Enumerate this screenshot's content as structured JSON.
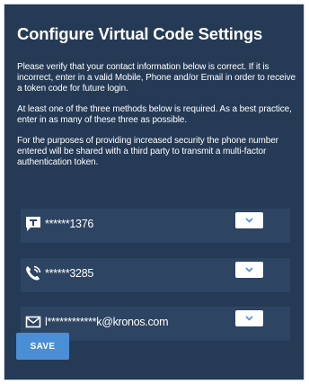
{
  "dialog": {
    "title": "Configure Virtual Code Settings",
    "paragraphs": [
      "Please verify that your contact information below is correct. If it is incorrect, enter in a valid Mobile, Phone and/or Email in order to receive a token code for future login.",
      "At least one of the three methods below is required. As a best practice, enter in as many of these three as possible.",
      "For the purposes of providing increased security the phone number entered will be shared with a third party to transmit a multi-factor authentication token."
    ]
  },
  "fields": [
    {
      "icon": "sms-message-icon",
      "value": "******1376"
    },
    {
      "icon": "phone-call-icon",
      "value": "******3285"
    },
    {
      "icon": "email-envelope-icon",
      "value": "l************k@kronos.com"
    }
  ],
  "dropdown_icon": "chevron-down-icon",
  "buttons": {
    "save_label": "SAVE"
  },
  "colors": {
    "panel_background": "#253a55",
    "field_background": "#2d4462",
    "accent": "#4a8fd6",
    "text": "#ffffff"
  }
}
